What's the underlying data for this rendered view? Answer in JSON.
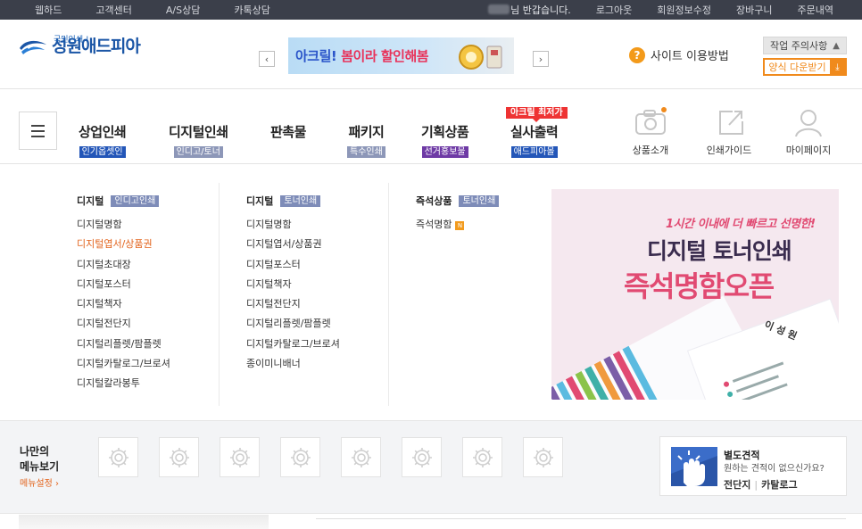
{
  "topbar": {
    "left_links": [
      "웹하드",
      "고객센터",
      "A/S상담",
      "카톡상담"
    ],
    "greeting": "님 반갑습니다.",
    "right_links": [
      "로그아웃",
      "회원정보수정",
      "장바구니",
      "주문내역"
    ]
  },
  "header": {
    "logo_sub": "국민인쇄 !",
    "logo_name": "성원애드피아",
    "banner_text_1": "아크릴!",
    "banner_text_2": "봄이라 할인해봄",
    "site_guide": "사이트 이용방법",
    "notice_label": "작업 주의사항",
    "download_label": "양식 다운받기"
  },
  "nav": {
    "hot_badge": "아크릴 최저가",
    "items": [
      {
        "label": "상업인쇄",
        "tag": "인기옵셋인",
        "color": "#2356b8"
      },
      {
        "label": "디지털인쇄",
        "tag": "인디고/토너",
        "color": "#8d97b8"
      },
      {
        "label": "판촉물",
        "tag": "",
        "color": ""
      },
      {
        "label": "패키지",
        "tag": "특수인쇄",
        "color": "#8d97b8"
      },
      {
        "label": "기획상품",
        "tag": "선거홍보물",
        "color": "#6e3aa5"
      },
      {
        "label": "실사출력",
        "tag": "애드피아몰",
        "color": "#2356b8"
      }
    ],
    "quick": [
      "상품소개",
      "인쇄가이드",
      "마이페이지"
    ]
  },
  "dropdown": {
    "col1": {
      "head": "디지털",
      "badge": "인디고인쇄",
      "items": [
        "디지털명함",
        "디지털엽서/상품권",
        "디지털초대장",
        "디지털포스터",
        "디지털책자",
        "디지털전단지",
        "디지털리플렛/팜플렛",
        "디지털카탈로그/브로셔",
        "디지털칼라봉투"
      ]
    },
    "col2": {
      "head": "디지털",
      "badge": "토너인쇄",
      "items": [
        "디지털명함",
        "디지털엽서/상품권",
        "디지털포스터",
        "디지털책자",
        "디지털전단지",
        "디지털리플렛/팜플렛",
        "디지털카탈로그/브로셔",
        "종이미니배너"
      ]
    },
    "col3": {
      "head": "즉석상품",
      "badge": "토너인쇄",
      "items": [
        "즉석명함"
      ],
      "new_badge": "N"
    },
    "promo": {
      "line1": "1시간 이내에 더 빠르고 선명한!",
      "line2": "디지털 토너인쇄",
      "line3": "즉석명함오픈",
      "card_name": "이 성 원"
    }
  },
  "mymenu": {
    "title_line1": "나만의",
    "title_line2": "메뉴보기",
    "settings": "메뉴설정",
    "estimate_title": "별도견적",
    "estimate_desc": "원하는 견적이 없으신가요?",
    "estimate_link1": "전단지",
    "estimate_link2": "카탈로그"
  }
}
